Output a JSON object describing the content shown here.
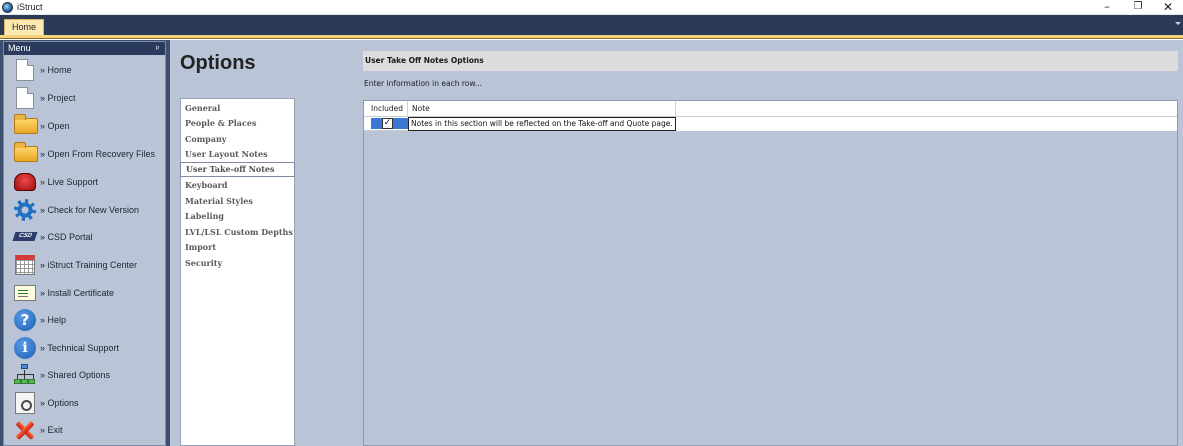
{
  "window": {
    "title": "iStruct",
    "controls": {
      "minimize": "–",
      "maximize": "❐",
      "close": "✕"
    }
  },
  "ribbon": {
    "tabs": [
      {
        "label": "Home",
        "active": true
      }
    ]
  },
  "menu": {
    "header": "Menu",
    "pin_glyph": "ᵖ",
    "items": [
      {
        "label": "» Home",
        "icon": "document-icon"
      },
      {
        "label": "» Project",
        "icon": "document-icon"
      },
      {
        "label": "» Open",
        "icon": "folder-icon"
      },
      {
        "label": "» Open From Recovery Files",
        "icon": "folder-icon"
      },
      {
        "label": "» Live Support",
        "icon": "phone-icon"
      },
      {
        "label": "» Check for New Version",
        "icon": "gear-icon"
      },
      {
        "label": "» CSD Portal",
        "icon": "csd-logo-icon",
        "icon_text": "CSD"
      },
      {
        "label": "» iStruct Training Center",
        "icon": "calendar-icon"
      },
      {
        "label": "» Install Certificate",
        "icon": "certificate-icon"
      },
      {
        "label": "» Help",
        "icon": "help-icon",
        "icon_text": "?"
      },
      {
        "label": "» Technical Support",
        "icon": "info-icon",
        "icon_text": "i"
      },
      {
        "label": "» Shared Options",
        "icon": "network-icon"
      },
      {
        "label": "» Options",
        "icon": "options-icon"
      },
      {
        "label": "» Exit",
        "icon": "exit-icon"
      }
    ]
  },
  "options": {
    "title": "Options",
    "categories": [
      {
        "label": "General"
      },
      {
        "label": "People & Places"
      },
      {
        "label": "Company"
      },
      {
        "label": "User Layout Notes"
      },
      {
        "label": "User Take-off Notes",
        "selected": true
      },
      {
        "label": "Keyboard"
      },
      {
        "label": "Material Styles"
      },
      {
        "label": "Labeling"
      },
      {
        "label": "LVL/LSL Custom Depths"
      },
      {
        "label": "Import"
      },
      {
        "label": "Security"
      }
    ]
  },
  "panel": {
    "header": "User Take Off Notes Options",
    "instruction": "Enter information in each row...",
    "columns": {
      "included": "Included",
      "note": "Note"
    },
    "rows": [
      {
        "included": true,
        "check_glyph": "✓",
        "note": "Notes in this section will be reflected on the Take-off and Quote page."
      }
    ]
  },
  "colors": {
    "ribbon_dark": "#2b3a55",
    "tab_active": "#fde8b2",
    "panel_bg": "#b9c4d6",
    "selection_blue": "#3a78d4"
  }
}
